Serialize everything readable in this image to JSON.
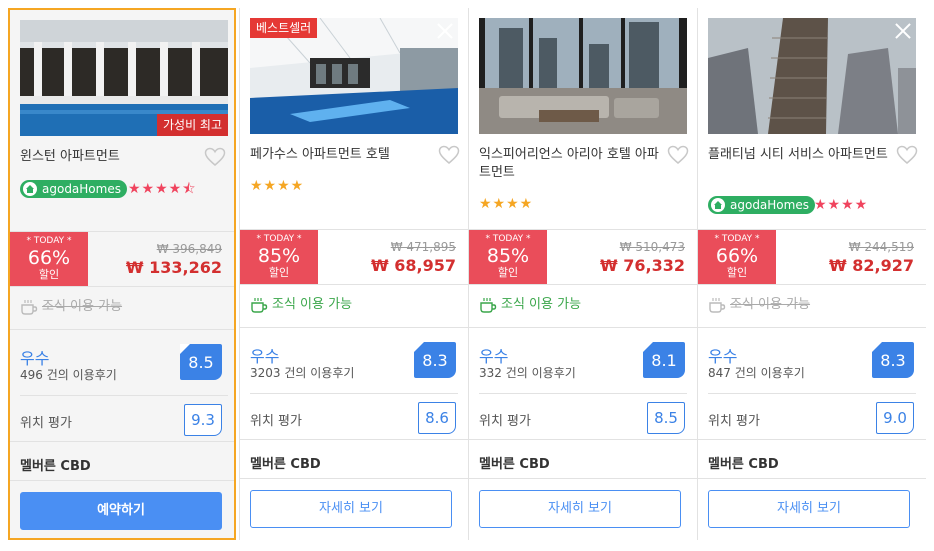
{
  "cards": [
    {
      "name": "윈스턴 아파트먼트",
      "corner_badge": "",
      "value_badge": "가성비 최고",
      "agoda_label": "agodaHomes",
      "stars": "★★★★⯪",
      "star_color": "pink",
      "today_label": "* TODAY *",
      "discount": "66%",
      "discount_label": "할인",
      "original_price": "₩ 396,849",
      "price": "₩ 133,262",
      "breakfast": "조식 이용 가능",
      "breakfast_available": false,
      "rating_word": "우수",
      "reviews": "496 건의 이용후기",
      "score": "8.5",
      "location_label": "위치 평가",
      "location_score": "9.3",
      "area": "멜버른 CBD",
      "button": "예약하기"
    },
    {
      "name": "페가수스 아파트먼트 호텔",
      "corner_badge": "베스트셀러",
      "value_badge": "",
      "agoda_label": "",
      "stars": "★★★★",
      "star_color": "gold",
      "today_label": "* TODAY *",
      "discount": "85%",
      "discount_label": "할인",
      "original_price": "₩ 471,895",
      "price": "₩ 68,957",
      "breakfast": "조식 이용 가능",
      "breakfast_available": true,
      "rating_word": "우수",
      "reviews": "3203 건의 이용후기",
      "score": "8.3",
      "location_label": "위치 평가",
      "location_score": "8.6",
      "area": "멜버른 CBD",
      "button": "자세히 보기"
    },
    {
      "name": "익스피어리언스 아리아 호텔 아파트먼트",
      "corner_badge": "",
      "value_badge": "",
      "agoda_label": "",
      "stars": "★★★★",
      "star_color": "gold",
      "today_label": "* TODAY *",
      "discount": "85%",
      "discount_label": "할인",
      "original_price": "₩ 510,473",
      "price": "₩ 76,332",
      "breakfast": "조식 이용 가능",
      "breakfast_available": true,
      "rating_word": "우수",
      "reviews": "332 건의 이용후기",
      "score": "8.1",
      "location_label": "위치 평가",
      "location_score": "8.5",
      "area": "멜버른 CBD",
      "button": "자세히 보기"
    },
    {
      "name": "플래티넘 시티 서비스 아파트먼트",
      "corner_badge": "",
      "value_badge": "",
      "agoda_label": "agodaHomes",
      "stars": "★★★★",
      "star_color": "pink",
      "today_label": "* TODAY *",
      "discount": "66%",
      "discount_label": "할인",
      "original_price": "₩ 244,519",
      "price": "₩ 82,927",
      "breakfast": "조식 이용 가능",
      "breakfast_available": false,
      "rating_word": "우수",
      "reviews": "847 건의 이용후기",
      "score": "8.3",
      "location_label": "위치 평가",
      "location_score": "9.0",
      "area": "멜버른 CBD",
      "button": "자세히 보기"
    }
  ],
  "colors": {
    "selected_border": "#f5a623",
    "today_red": "#ea4d5a",
    "price_red": "#d32f2f",
    "score_blue": "#3b82e6",
    "breakfast_green": "#3aa64a",
    "agoda_green": "#2eae62"
  },
  "icons": {
    "heart": "heart-outline-icon",
    "close": "close-icon",
    "cup": "coffee-cup-icon",
    "home": "home-icon"
  }
}
